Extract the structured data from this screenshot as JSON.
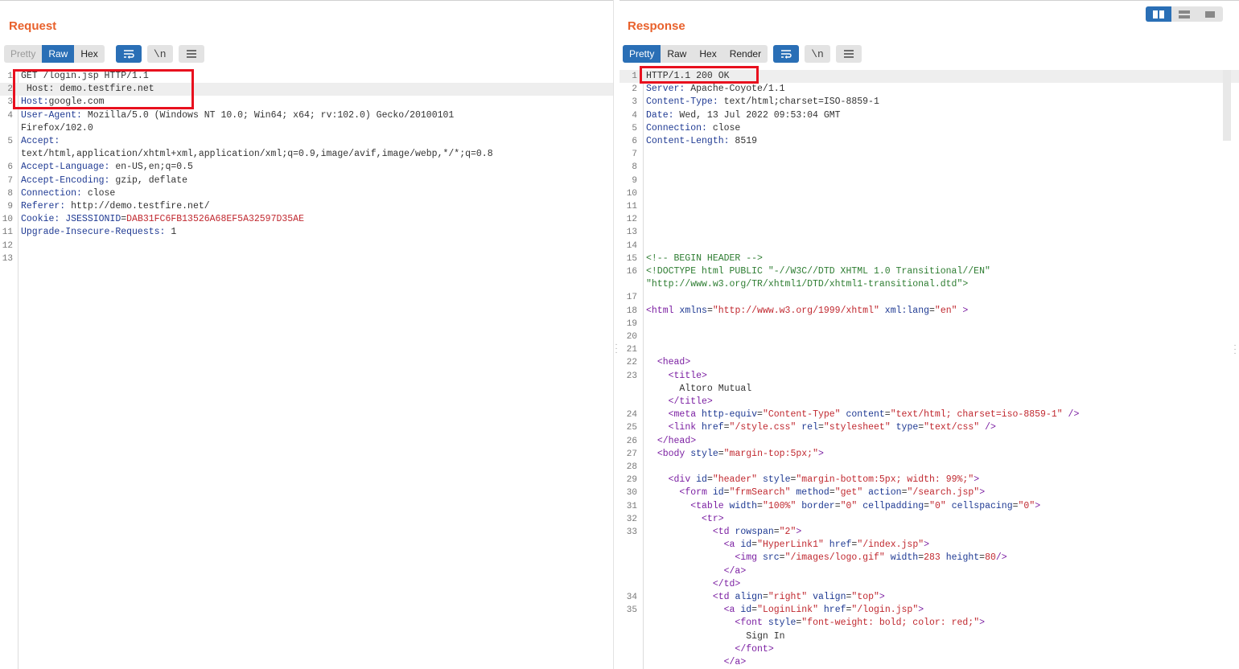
{
  "request": {
    "title": "Request",
    "tabs": [
      {
        "label": "Pretty",
        "state": "disabled"
      },
      {
        "label": "Raw",
        "state": "active"
      },
      {
        "label": "Hex",
        "state": "normal"
      }
    ],
    "icons": [
      "wrap-lines-icon",
      "newline-icon",
      "menu-icon"
    ],
    "newline_label": "\\n",
    "lines": [
      {
        "n": "1",
        "parts": [
          [
            "v",
            "GET /login.jsp HTTP/1.1"
          ]
        ]
      },
      {
        "n": "2",
        "parts": [
          [
            "v",
            " Host: demo.testfire.net"
          ]
        ],
        "hl": true
      },
      {
        "n": "3",
        "parts": [
          [
            "k",
            "Host:"
          ],
          [
            "v",
            "google.com"
          ]
        ]
      },
      {
        "n": "4",
        "parts": [
          [
            "k",
            "User-Agent: "
          ],
          [
            "v",
            "Mozilla/5.0 (Windows NT 10.0; Win64; x64; rv:102.0) Gecko/20100101"
          ]
        ]
      },
      {
        "n": "",
        "parts": [
          [
            "v",
            "Firefox/102.0"
          ]
        ]
      },
      {
        "n": "5",
        "parts": [
          [
            "k",
            "Accept:"
          ]
        ]
      },
      {
        "n": "",
        "parts": [
          [
            "v",
            "text/html,application/xhtml+xml,application/xml;q=0.9,image/avif,image/webp,*/*;q=0.8"
          ]
        ]
      },
      {
        "n": "6",
        "parts": [
          [
            "k",
            "Accept-Language: "
          ],
          [
            "v",
            "en-US,en;q=0.5"
          ]
        ]
      },
      {
        "n": "7",
        "parts": [
          [
            "k",
            "Accept-Encoding: "
          ],
          [
            "v",
            "gzip, deflate"
          ]
        ]
      },
      {
        "n": "8",
        "parts": [
          [
            "k",
            "Connection: "
          ],
          [
            "v",
            "close"
          ]
        ]
      },
      {
        "n": "9",
        "parts": [
          [
            "k",
            "Referer: "
          ],
          [
            "v",
            "http://demo.testfire.net/"
          ]
        ]
      },
      {
        "n": "10",
        "parts": [
          [
            "k",
            "Cookie: "
          ],
          [
            "attr",
            "JSESSIONID"
          ],
          [
            "v",
            "="
          ],
          [
            "cookie-v",
            "DAB31FC6FB13526A68EF5A32597D35AE"
          ]
        ]
      },
      {
        "n": "11",
        "parts": [
          [
            "k",
            "Upgrade-Insecure-Requests: "
          ],
          [
            "v",
            "1"
          ]
        ]
      },
      {
        "n": "12",
        "parts": []
      },
      {
        "n": "13",
        "parts": []
      }
    ]
  },
  "response": {
    "title": "Response",
    "tabs": [
      {
        "label": "Pretty",
        "state": "active"
      },
      {
        "label": "Raw",
        "state": "normal"
      },
      {
        "label": "Hex",
        "state": "normal"
      },
      {
        "label": "Render",
        "state": "normal"
      }
    ],
    "icons": [
      "wrap-lines-icon",
      "newline-icon",
      "menu-icon"
    ],
    "newline_label": "\\n",
    "lines": [
      {
        "n": "1",
        "parts": [
          [
            "v",
            "HTTP/1.1 200 OK"
          ]
        ],
        "hl": true
      },
      {
        "n": "2",
        "parts": [
          [
            "k",
            "Server: "
          ],
          [
            "v",
            "Apache-Coyote/1.1"
          ]
        ]
      },
      {
        "n": "3",
        "parts": [
          [
            "k",
            "Content-Type: "
          ],
          [
            "v",
            "text/html;charset=ISO-8859-1"
          ]
        ]
      },
      {
        "n": "4",
        "parts": [
          [
            "k",
            "Date: "
          ],
          [
            "v",
            "Wed, 13 Jul 2022 09:53:04 GMT"
          ]
        ]
      },
      {
        "n": "5",
        "parts": [
          [
            "k",
            "Connection: "
          ],
          [
            "v",
            "close"
          ]
        ]
      },
      {
        "n": "6",
        "parts": [
          [
            "k",
            "Content-Length: "
          ],
          [
            "v",
            "8519"
          ]
        ]
      },
      {
        "n": "7",
        "parts": []
      },
      {
        "n": "8",
        "parts": []
      },
      {
        "n": "9",
        "parts": []
      },
      {
        "n": "10",
        "parts": []
      },
      {
        "n": "11",
        "parts": []
      },
      {
        "n": "12",
        "parts": []
      },
      {
        "n": "13",
        "parts": []
      },
      {
        "n": "14",
        "parts": []
      },
      {
        "n": "15",
        "parts": [
          [
            "cmt",
            "<!-- BEGIN HEADER -->"
          ]
        ]
      },
      {
        "n": "16",
        "parts": [
          [
            "cmt",
            "<!DOCTYPE html PUBLIC \"-//W3C//DTD XHTML 1.0 Transitional//EN\""
          ]
        ]
      },
      {
        "n": "",
        "parts": [
          [
            "cmt",
            "\"http://www.w3.org/TR/xhtml1/DTD/xhtml1-transitional.dtd\">"
          ]
        ]
      },
      {
        "n": "17",
        "parts": []
      },
      {
        "n": "18",
        "parts": [
          [
            "tag",
            "<html "
          ],
          [
            "attr",
            "xmlns"
          ],
          [
            "v",
            "="
          ],
          [
            "str",
            "\"http://www.w3.org/1999/xhtml\""
          ],
          [
            "v",
            " "
          ],
          [
            "attr",
            "xml:lang"
          ],
          [
            "v",
            "="
          ],
          [
            "str",
            "\"en\""
          ],
          [
            "tag",
            " >"
          ]
        ]
      },
      {
        "n": "19",
        "parts": []
      },
      {
        "n": "20",
        "parts": []
      },
      {
        "n": "21",
        "parts": []
      },
      {
        "n": "22",
        "parts": [
          [
            "v",
            "  "
          ],
          [
            "tag",
            "<head>"
          ]
        ]
      },
      {
        "n": "23",
        "parts": [
          [
            "v",
            "    "
          ],
          [
            "tag",
            "<title>"
          ]
        ]
      },
      {
        "n": "",
        "parts": [
          [
            "v",
            "      Altoro Mutual"
          ]
        ]
      },
      {
        "n": "",
        "parts": [
          [
            "v",
            "    "
          ],
          [
            "tag",
            "</title>"
          ]
        ]
      },
      {
        "n": "24",
        "parts": [
          [
            "v",
            "    "
          ],
          [
            "tag",
            "<meta "
          ],
          [
            "attr",
            "http-equiv"
          ],
          [
            "v",
            "="
          ],
          [
            "str",
            "\"Content-Type\""
          ],
          [
            "v",
            " "
          ],
          [
            "attr",
            "content"
          ],
          [
            "v",
            "="
          ],
          [
            "str",
            "\"text/html; charset=iso-8859-1\""
          ],
          [
            "tag",
            " />"
          ]
        ]
      },
      {
        "n": "25",
        "parts": [
          [
            "v",
            "    "
          ],
          [
            "tag",
            "<link "
          ],
          [
            "attr",
            "href"
          ],
          [
            "v",
            "="
          ],
          [
            "str",
            "\"/style.css\""
          ],
          [
            "v",
            " "
          ],
          [
            "attr",
            "rel"
          ],
          [
            "v",
            "="
          ],
          [
            "str",
            "\"stylesheet\""
          ],
          [
            "v",
            " "
          ],
          [
            "attr",
            "type"
          ],
          [
            "v",
            "="
          ],
          [
            "str",
            "\"text/css\""
          ],
          [
            "tag",
            " />"
          ]
        ]
      },
      {
        "n": "26",
        "parts": [
          [
            "v",
            "  "
          ],
          [
            "tag",
            "</head>"
          ]
        ]
      },
      {
        "n": "27",
        "parts": [
          [
            "v",
            "  "
          ],
          [
            "tag",
            "<body "
          ],
          [
            "attr",
            "style"
          ],
          [
            "v",
            "="
          ],
          [
            "str",
            "\"margin-top:5px;\""
          ],
          [
            "tag",
            ">"
          ]
        ]
      },
      {
        "n": "28",
        "parts": []
      },
      {
        "n": "29",
        "parts": [
          [
            "v",
            "    "
          ],
          [
            "tag",
            "<div "
          ],
          [
            "attr",
            "id"
          ],
          [
            "v",
            "="
          ],
          [
            "str",
            "\"header\""
          ],
          [
            "v",
            " "
          ],
          [
            "attr",
            "style"
          ],
          [
            "v",
            "="
          ],
          [
            "str",
            "\"margin-bottom:5px; width: 99%;\""
          ],
          [
            "tag",
            ">"
          ]
        ]
      },
      {
        "n": "30",
        "parts": [
          [
            "v",
            "      "
          ],
          [
            "tag",
            "<form "
          ],
          [
            "attr",
            "id"
          ],
          [
            "v",
            "="
          ],
          [
            "str",
            "\"frmSearch\""
          ],
          [
            "v",
            " "
          ],
          [
            "attr",
            "method"
          ],
          [
            "v",
            "="
          ],
          [
            "str",
            "\"get\""
          ],
          [
            "v",
            " "
          ],
          [
            "attr",
            "action"
          ],
          [
            "v",
            "="
          ],
          [
            "str",
            "\"/search.jsp\""
          ],
          [
            "tag",
            ">"
          ]
        ]
      },
      {
        "n": "31",
        "parts": [
          [
            "v",
            "        "
          ],
          [
            "tag",
            "<table "
          ],
          [
            "attr",
            "width"
          ],
          [
            "v",
            "="
          ],
          [
            "str",
            "\"100%\""
          ],
          [
            "v",
            " "
          ],
          [
            "attr",
            "border"
          ],
          [
            "v",
            "="
          ],
          [
            "str",
            "\"0\""
          ],
          [
            "v",
            " "
          ],
          [
            "attr",
            "cellpadding"
          ],
          [
            "v",
            "="
          ],
          [
            "str",
            "\"0\""
          ],
          [
            "v",
            " "
          ],
          [
            "attr",
            "cellspacing"
          ],
          [
            "v",
            "="
          ],
          [
            "str",
            "\"0\""
          ],
          [
            "tag",
            ">"
          ]
        ]
      },
      {
        "n": "32",
        "parts": [
          [
            "v",
            "          "
          ],
          [
            "tag",
            "<tr>"
          ]
        ]
      },
      {
        "n": "33",
        "parts": [
          [
            "v",
            "            "
          ],
          [
            "tag",
            "<td "
          ],
          [
            "attr",
            "rowspan"
          ],
          [
            "v",
            "="
          ],
          [
            "str",
            "\"2\""
          ],
          [
            "tag",
            ">"
          ]
        ]
      },
      {
        "n": "",
        "parts": [
          [
            "v",
            "              "
          ],
          [
            "tag",
            "<a "
          ],
          [
            "attr",
            "id"
          ],
          [
            "v",
            "="
          ],
          [
            "str",
            "\"HyperLink1\""
          ],
          [
            "v",
            " "
          ],
          [
            "attr",
            "href"
          ],
          [
            "v",
            "="
          ],
          [
            "str",
            "\"/index.jsp\""
          ],
          [
            "tag",
            ">"
          ]
        ]
      },
      {
        "n": "",
        "parts": [
          [
            "v",
            "                "
          ],
          [
            "tag",
            "<img "
          ],
          [
            "attr",
            "src"
          ],
          [
            "v",
            "="
          ],
          [
            "str",
            "\"/images/logo.gif\""
          ],
          [
            "v",
            " "
          ],
          [
            "attr",
            "width"
          ],
          [
            "v",
            "="
          ],
          [
            "str",
            "283"
          ],
          [
            "v",
            " "
          ],
          [
            "attr",
            "height"
          ],
          [
            "v",
            "="
          ],
          [
            "str",
            "80"
          ],
          [
            "tag",
            "/>"
          ]
        ]
      },
      {
        "n": "",
        "parts": [
          [
            "v",
            "              "
          ],
          [
            "tag",
            "</a>"
          ]
        ]
      },
      {
        "n": "",
        "parts": [
          [
            "v",
            "            "
          ],
          [
            "tag",
            "</td>"
          ]
        ]
      },
      {
        "n": "34",
        "parts": [
          [
            "v",
            "            "
          ],
          [
            "tag",
            "<td "
          ],
          [
            "attr",
            "align"
          ],
          [
            "v",
            "="
          ],
          [
            "str",
            "\"right\""
          ],
          [
            "v",
            " "
          ],
          [
            "attr",
            "valign"
          ],
          [
            "v",
            "="
          ],
          [
            "str",
            "\"top\""
          ],
          [
            "tag",
            ">"
          ]
        ]
      },
      {
        "n": "35",
        "parts": [
          [
            "v",
            "              "
          ],
          [
            "tag",
            "<a "
          ],
          [
            "attr",
            "id"
          ],
          [
            "v",
            "="
          ],
          [
            "str",
            "\"LoginLink\""
          ],
          [
            "v",
            " "
          ],
          [
            "attr",
            "href"
          ],
          [
            "v",
            "="
          ],
          [
            "str",
            "\"/login.jsp\""
          ],
          [
            "tag",
            ">"
          ]
        ]
      },
      {
        "n": "",
        "parts": [
          [
            "v",
            "                "
          ],
          [
            "tag",
            "<font "
          ],
          [
            "attr",
            "style"
          ],
          [
            "v",
            "="
          ],
          [
            "str",
            "\"font-weight: bold; color: red;\""
          ],
          [
            "tag",
            ">"
          ]
        ]
      },
      {
        "n": "",
        "parts": [
          [
            "v",
            "                  Sign In"
          ]
        ]
      },
      {
        "n": "",
        "parts": [
          [
            "v",
            "                "
          ],
          [
            "tag",
            "</font>"
          ]
        ]
      },
      {
        "n": "",
        "parts": [
          [
            "v",
            "              "
          ],
          [
            "tag",
            "</a>"
          ]
        ]
      }
    ]
  },
  "layout_switch": [
    "side-by-side-icon",
    "stacked-icon",
    "single-pane-icon"
  ],
  "colors": {
    "accent": "#2a6fb6",
    "title": "#e8612c",
    "highlight_box": "#e8101e"
  }
}
